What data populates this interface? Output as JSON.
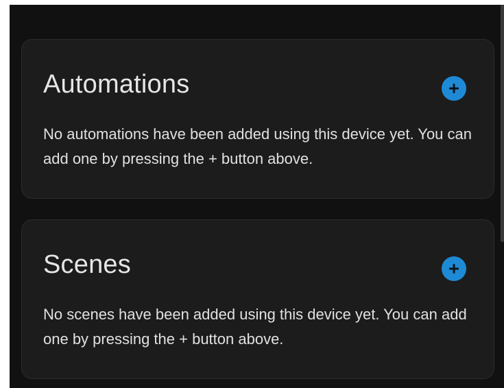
{
  "automations": {
    "title": "Automations",
    "empty_text": "No automations have been added using this device yet. You can add one by pressing the + button above.",
    "add_icon": "plus-circle-icon"
  },
  "scenes": {
    "title": "Scenes",
    "empty_text": "No scenes have been added using this device yet. You can add one by pressing the + button above.",
    "add_icon": "plus-circle-icon"
  },
  "colors": {
    "background": "#111111",
    "card": "#1c1c1c",
    "accent": "#1e8ad6",
    "text": "#e1e1e1"
  }
}
